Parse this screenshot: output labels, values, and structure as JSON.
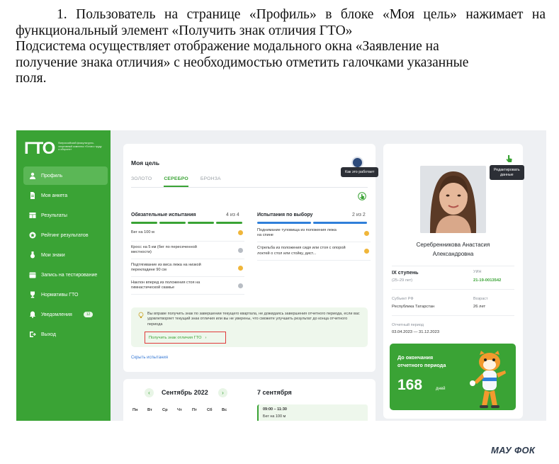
{
  "document": {
    "para1": "1. Пользователь на странице «Профиль» в блоке «Моя цель» нажимает на функциональный элемент «Получить знак отличия ГТО»",
    "para2_line1": "Подсистема осуществляет отображение модального окна «Заявление на",
    "para2_line2": "получение знака отличия» с необходимостью отметить галочками указанные",
    "para2_line3": "поля."
  },
  "sidebar": {
    "logo_mark": "ГТО",
    "logo_text": "Всероссийский физкультурно-спортивный комплекс «Готов к труду и обороне»",
    "items": [
      {
        "label": "Профиль",
        "icon": "person-icon",
        "active": true
      },
      {
        "label": "Моя анкета",
        "icon": "document-icon"
      },
      {
        "label": "Результаты",
        "icon": "table-icon"
      },
      {
        "label": "Рейтинг результатов",
        "icon": "rating-icon"
      },
      {
        "label": "Мои знаки",
        "icon": "medal-icon"
      },
      {
        "label": "Запись на тестирование",
        "icon": "calendar-icon"
      },
      {
        "label": "Нормативы ГТО",
        "icon": "trophy-icon"
      },
      {
        "label": "Уведомления",
        "icon": "bell-icon",
        "badge": "12"
      },
      {
        "label": "Выход",
        "icon": "exit-icon"
      }
    ]
  },
  "goal": {
    "title": "Моя цель",
    "tabs": [
      "ЗОЛОТО",
      "СЕРЕБРО",
      "БРОНЗА"
    ],
    "active_tab": 1,
    "help_tooltip": "Как это работает",
    "mandatory": {
      "title": "Обязательные испытания",
      "count": "4 из 4",
      "items": [
        {
          "text": "Бег на 100 м",
          "status": "yellow"
        },
        {
          "text": "Кросс на 5 км (бег по пересеченной местности)",
          "status": "gray"
        },
        {
          "text": "Подтягивание из виса лежа на низкой перекладине 90 см",
          "status": "yellow"
        },
        {
          "text": "Наклон вперед из положения стоя на гимнастической скамье",
          "status": "gray"
        }
      ]
    },
    "optional": {
      "title": "Испытания по выбору",
      "count": "2 из 2",
      "items": [
        {
          "text": "Поднимание туловища из положения лежа на спине",
          "status": "yellow"
        },
        {
          "text": "Стрельба из положения сидя или стоя с опорой локтей о стол или стойку, дист...",
          "status": "yellow"
        }
      ]
    },
    "notice_text": "Вы вправе получить знак по завершении текущего квартала, не дожидаясь завершения отчетного периода, если вас удовлетворяет текущий знак отличия или вы не уверены, что сможете улучшить результат до конца отчетного периода",
    "get_badge_label": "Получить знак отличия ГТО",
    "hide_tests_label": "Скрыть испытания"
  },
  "calendar": {
    "month": "Сентябрь 2022",
    "weekdays": [
      "Пн",
      "Вт",
      "Ср",
      "Чт",
      "Пт",
      "Сб",
      "Вс"
    ],
    "selected_date": "7 сентября",
    "event_time": "09:00 – 11:30",
    "event_name": "Бег на 100 м"
  },
  "profile": {
    "edit_tooltip_line1": "Редактировать",
    "edit_tooltip_line2": "данные",
    "name_line1": "Серебренникова Анастасия",
    "name_line2": "Александровна",
    "stage": "IX ступень",
    "age_range": "(25–29 лет)",
    "uin_label": "УИН",
    "uin_value": "21-19-0013542",
    "region_label": "Субъект РФ",
    "region_value": "Республика Татарстан",
    "age_label": "Возраст",
    "age_value": "26 лет",
    "period_label": "Отчетный период",
    "period_value": "03.04.2023 — 31.12.2023",
    "promo_title_line1": "До окончания",
    "promo_title_line2": "отчетного периода",
    "promo_days": "168",
    "promo_unit": "дней"
  },
  "watermark": "МАУ ФОК",
  "colors": {
    "brand_green": "#3aa335",
    "accent_blue": "#2f7fd9",
    "highlight_red": "#e03a3a",
    "status_yellow": "#f0b63a",
    "status_gray": "#b8bdc4"
  }
}
